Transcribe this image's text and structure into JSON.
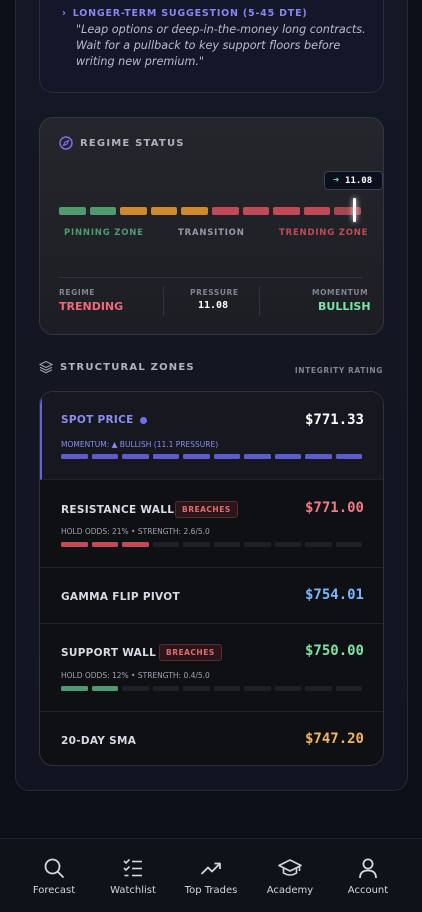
{
  "suggestion": {
    "heading": "LONGER-TERM SUGGESTION (5-45 DTE)",
    "text": "\"Leap options or deep-in-the-money long contracts. Wait for a pullback to key support floors before writing new premium.\""
  },
  "regime": {
    "title": "REGIME STATUS",
    "pressure_tag": "11.08",
    "gauge_segments": [
      "#4f9b6d",
      "#4f9b6d",
      "#d08a2c",
      "#d08a2c",
      "#d08a2c",
      "#c24a57",
      "#c24a57",
      "#c24a57",
      "#c24a57",
      "#c24a57"
    ],
    "gauge_level": 0.97,
    "zones": [
      "PINNING ZONE",
      "TRANSITION",
      "TRENDING ZONE"
    ],
    "zone_colors": [
      "#4f9b6d",
      "#9499a6",
      "#c24a57"
    ],
    "stats": [
      {
        "caption": "REGIME",
        "value": "TRENDING",
        "color": "#f06b78"
      },
      {
        "caption": "PRESSURE",
        "value": "11.08",
        "color": "#ffffff"
      },
      {
        "caption": "MOMENTUM",
        "value": "BULLISH",
        "color": "#7ee3a6"
      }
    ]
  },
  "zones": {
    "title": "STRUCTURAL ZONES",
    "integrity_label": "INTEGRITY RATING",
    "rows": [
      {
        "name": "SPOT PRICE",
        "price": "$771.33",
        "price_color": "#ffffff",
        "sub": "MOMENTUM: ▲ BULLISH (11.1 PRESSURE)",
        "filled": 10,
        "fill_color": "#5b5ccf"
      },
      {
        "name": "RESISTANCE WALL",
        "badge": "BREACHES",
        "price": "$771.00",
        "price_color": "#f07a86",
        "sub": "HOLD ODDS: 21% • STRENGTH: 2.6/5.0",
        "filled": 3,
        "fill_color": "#c24a57"
      },
      {
        "name": "GAMMA FLIP PIVOT",
        "price": "$754.01",
        "price_color": "#7ab6ff"
      },
      {
        "name": "SUPPORT WALL",
        "badge": "BREACHES",
        "price": "$750.00",
        "price_color": "#7ee3a6",
        "sub": "HOLD ODDS: 12% • STRENGTH: 0.4/5.0",
        "filled": 2,
        "fill_color": "#4f9b6d"
      },
      {
        "name": "20-DAY SMA",
        "price": "$747.20",
        "price_color": "#f2b560"
      }
    ]
  },
  "nav": {
    "items": [
      {
        "label": "Forecast",
        "icon": "search-icon"
      },
      {
        "label": "Watchlist",
        "icon": "checklist-icon"
      },
      {
        "label": "Top Trades",
        "icon": "trending-up-icon"
      },
      {
        "label": "Academy",
        "icon": "graduation-cap-icon"
      },
      {
        "label": "Account",
        "icon": "user-icon"
      }
    ]
  }
}
